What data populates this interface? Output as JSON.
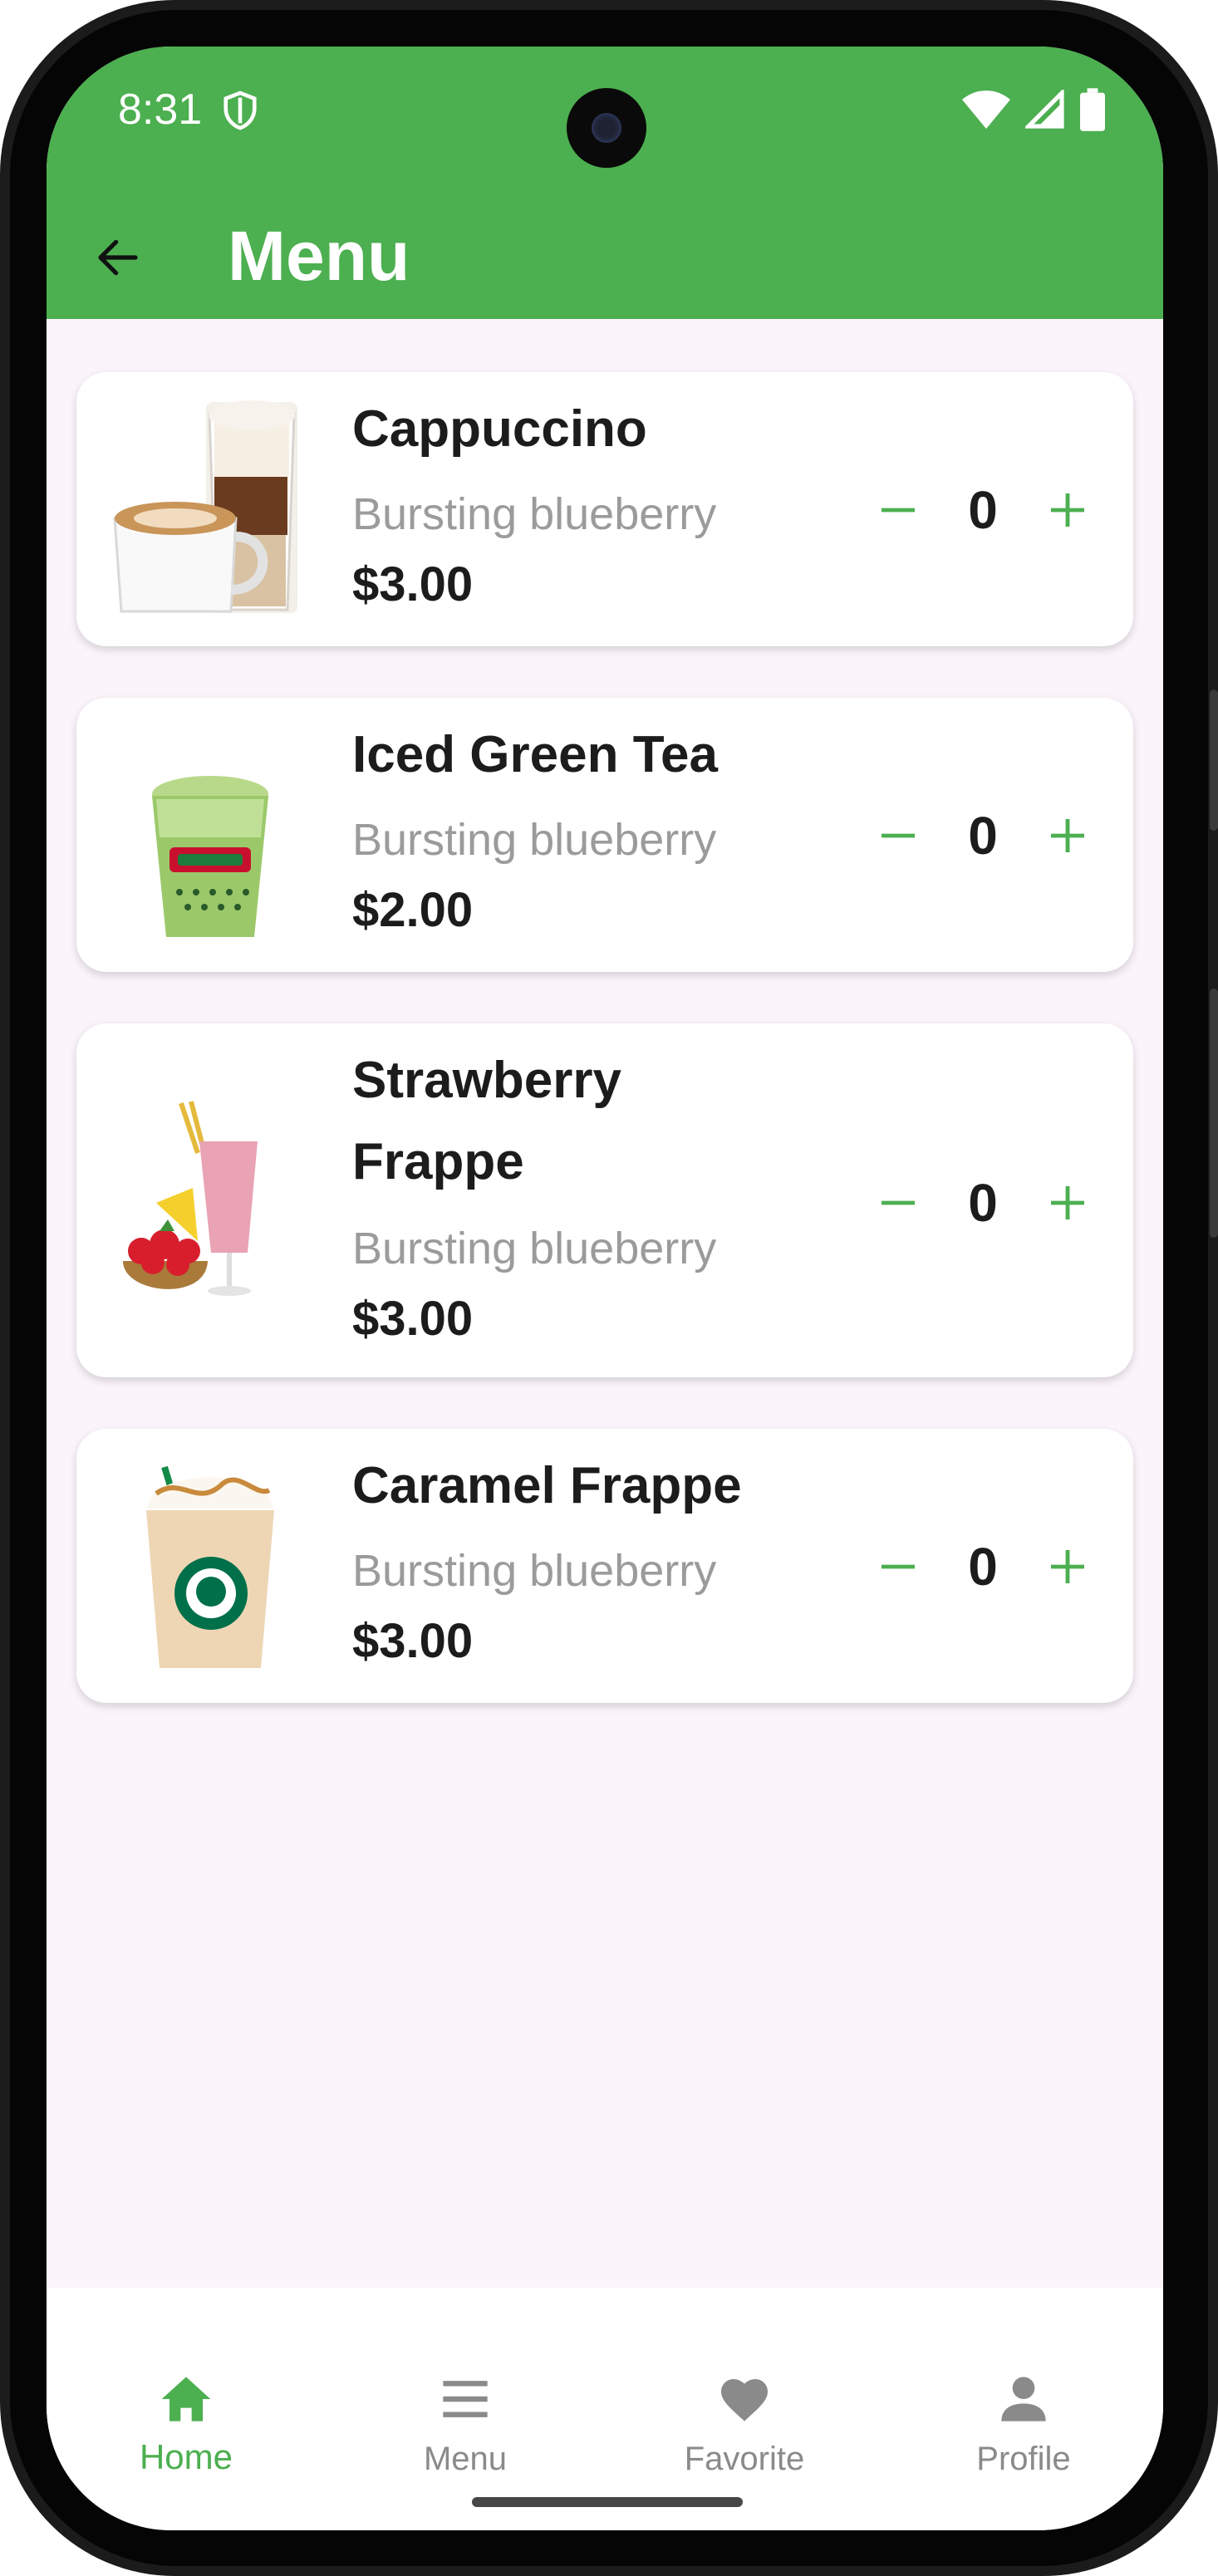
{
  "status_bar": {
    "time": "8:31"
  },
  "app_bar": {
    "title": "Menu"
  },
  "items": [
    {
      "name": "Cappuccino",
      "description": "Bursting blueberry",
      "price": "$3.00",
      "quantity": "0",
      "image": "cappuccino-drink-image"
    },
    {
      "name": "Iced Green Tea",
      "description": "Bursting blueberry",
      "price": "$2.00",
      "quantity": "0",
      "image": "iced-green-tea-image"
    },
    {
      "name": "Strawberry Frappe",
      "description": "Bursting blueberry",
      "price": "$3.00",
      "quantity": "0",
      "image": "strawberry-frappe-image"
    },
    {
      "name": "Caramel Frappe",
      "description": "Bursting blueberry",
      "price": "$3.00",
      "quantity": "0",
      "image": "caramel-frappe-image"
    }
  ],
  "bottom_nav": {
    "items": [
      {
        "label": "Home",
        "icon": "home-icon",
        "active": true
      },
      {
        "label": "Menu",
        "icon": "menu-icon",
        "active": false
      },
      {
        "label": "Favorite",
        "icon": "heart-icon",
        "active": false
      },
      {
        "label": "Profile",
        "icon": "person-icon",
        "active": false
      }
    ]
  },
  "colors": {
    "accent": "#4caf50",
    "background": "#fbf5fb",
    "card": "#ffffff",
    "text_primary": "#1c1c1c",
    "text_secondary": "#9b9b9b",
    "nav_inactive": "#8a8a8a"
  }
}
